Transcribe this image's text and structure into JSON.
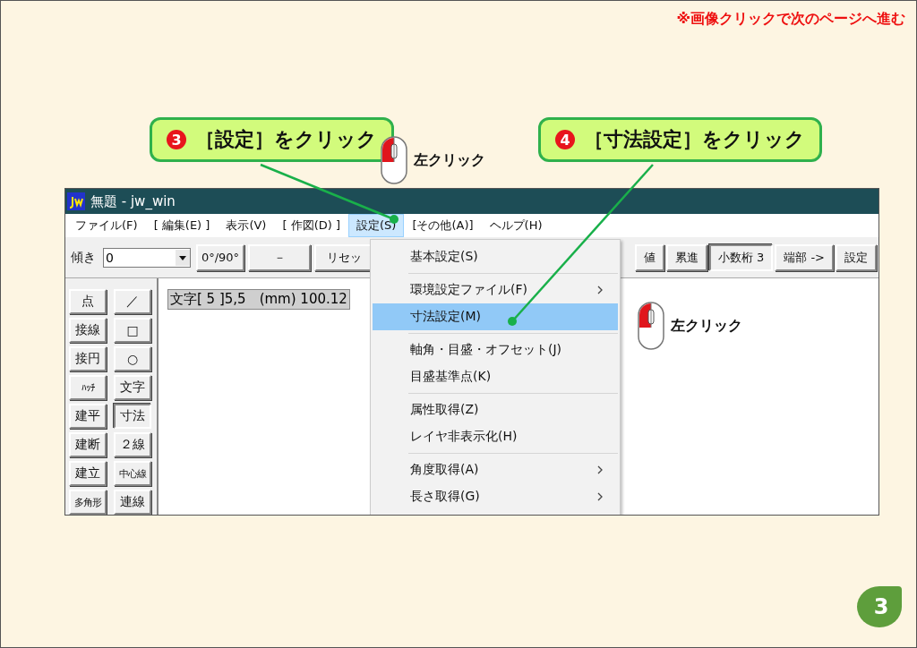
{
  "notice": "※画像クリックで次のページへ進む",
  "callouts": [
    {
      "number": "3",
      "text": "［設定］をクリック"
    },
    {
      "number": "4",
      "text": "［寸法設定］をクリック"
    }
  ],
  "mouse_hints": [
    {
      "label": "左クリック"
    },
    {
      "label": "左クリック"
    }
  ],
  "window": {
    "title": "無題 - jw_win",
    "menu": [
      {
        "label": "ファイル(F)",
        "selected": false
      },
      {
        "label": "[ 編集(E) ]",
        "selected": false
      },
      {
        "label": "表示(V)",
        "selected": false
      },
      {
        "label": "[ 作図(D) ]",
        "selected": false
      },
      {
        "label": "設定(S)",
        "selected": true
      },
      {
        "label": "[その他(A)]",
        "selected": false
      },
      {
        "label": "ヘルプ(H)",
        "selected": false
      }
    ],
    "toolbar": {
      "tilt_label": "傾き",
      "tilt_value": "0",
      "left_buttons": [
        {
          "label": "0°/90°",
          "pressed": false
        },
        {
          "label": "－",
          "pressed": false
        },
        {
          "label": "リセッ",
          "pressed": false
        }
      ],
      "right_buttons": [
        {
          "label": "値",
          "pressed": false
        },
        {
          "label": "累進",
          "pressed": false
        },
        {
          "label": "小数桁 3",
          "pressed": true
        },
        {
          "label": "端部 ->",
          "pressed": false
        },
        {
          "label": "設定",
          "pressed": false
        }
      ]
    },
    "tools": {
      "column_1": [
        {
          "label": "点",
          "pressed": false
        },
        {
          "label": "接線",
          "pressed": false
        },
        {
          "label": "接円",
          "pressed": false
        },
        {
          "label": "ﾊｯﾁ",
          "pressed": false
        },
        {
          "label": "建平",
          "pressed": false
        },
        {
          "label": "建断",
          "pressed": false
        },
        {
          "label": "建立",
          "pressed": false
        },
        {
          "label": "多角形",
          "pressed": false
        }
      ],
      "column_2": [
        {
          "label": "／",
          "pressed": false
        },
        {
          "label": "□",
          "pressed": false
        },
        {
          "label": "○",
          "pressed": false
        },
        {
          "label": "文字",
          "pressed": false
        },
        {
          "label": "寸法",
          "pressed": true
        },
        {
          "label": "２線",
          "pressed": false
        },
        {
          "label": "中心線",
          "pressed": false
        },
        {
          "label": "連線",
          "pressed": false
        }
      ]
    },
    "status_text": "文字[ 5 ]5,5　(mm) 100.12",
    "dropdown": [
      {
        "kind": "item",
        "label": "基本設定(S)",
        "submenu": false,
        "selected": false
      },
      {
        "kind": "separator"
      },
      {
        "kind": "item",
        "label": "環境設定ファイル(F)",
        "submenu": true,
        "selected": false
      },
      {
        "kind": "item",
        "label": "寸法設定(M)",
        "submenu": false,
        "selected": true
      },
      {
        "kind": "separator"
      },
      {
        "kind": "item",
        "label": "軸角・目盛・オフセット(J)",
        "submenu": false,
        "selected": false
      },
      {
        "kind": "item",
        "label": "目盛基準点(K)",
        "submenu": false,
        "selected": false
      },
      {
        "kind": "separator"
      },
      {
        "kind": "item",
        "label": "属性取得(Z)",
        "submenu": false,
        "selected": false
      },
      {
        "kind": "item",
        "label": "レイヤ非表示化(H)",
        "submenu": false,
        "selected": false
      },
      {
        "kind": "separator"
      },
      {
        "kind": "item",
        "label": "角度取得(A)",
        "submenu": true,
        "selected": false
      },
      {
        "kind": "item",
        "label": "長さ取得(G)",
        "submenu": true,
        "selected": false
      }
    ]
  },
  "page_number": "3"
}
